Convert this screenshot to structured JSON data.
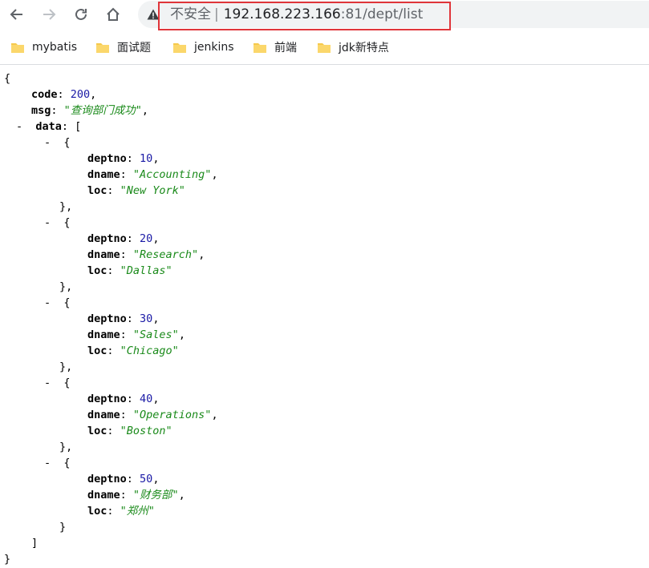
{
  "browser": {
    "nav": {
      "back_icon": "arrow-left-icon",
      "forward_icon": "arrow-right-icon",
      "reload_icon": "reload-icon",
      "home_icon": "home-icon"
    },
    "address_bar": {
      "security_label": "不安全",
      "separator": "|",
      "host": "192.168.223.166",
      "path": ":81/dept/list",
      "warning_icon": "warning-triangle-icon",
      "highlight_color": "#e0353a"
    },
    "bookmarks": [
      {
        "label": "mybatis",
        "icon": "folder-icon"
      },
      {
        "label": "面试题",
        "icon": "folder-icon"
      },
      {
        "label": "jenkins",
        "icon": "folder-icon"
      },
      {
        "label": "前端",
        "icon": "folder-icon"
      },
      {
        "label": "jdk新特点",
        "icon": "folder-icon"
      }
    ]
  },
  "json_view": {
    "open_brace": "{",
    "close_brace": "}",
    "code_key": "code",
    "code_value": "200",
    "msg_key": "msg",
    "msg_value": "\"查询部门成功\"",
    "data_key": "data",
    "collapse_marker": "-",
    "keys": {
      "deptno": "deptno",
      "dname": "dname",
      "loc": "loc"
    },
    "items": [
      {
        "deptno": "10",
        "dname": "\"Accounting\"",
        "loc": "\"New York\""
      },
      {
        "deptno": "20",
        "dname": "\"Research\"",
        "loc": "\"Dallas\""
      },
      {
        "deptno": "30",
        "dname": "\"Sales\"",
        "loc": "\"Chicago\""
      },
      {
        "deptno": "40",
        "dname": "\"Operations\"",
        "loc": "\"Boston\""
      },
      {
        "deptno": "50",
        "dname": "\"财务部\"",
        "loc": "\"郑州\""
      }
    ]
  }
}
